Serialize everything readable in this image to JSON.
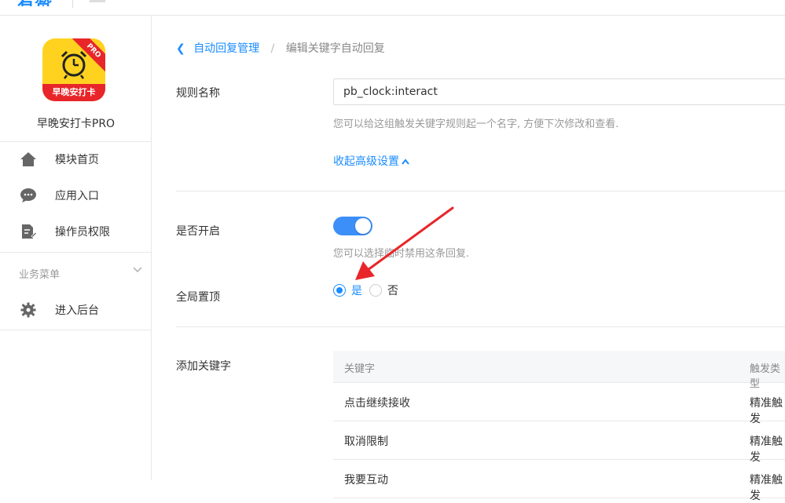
{
  "topbar": {
    "logo_text": "有赞"
  },
  "sidebar": {
    "app_name": "早晚安打卡PRO",
    "app_icon": {
      "ribbon": "PRO",
      "band": "早晚安打卡"
    },
    "items": [
      {
        "label": "模块首页",
        "icon": "home-icon"
      },
      {
        "label": "应用入口",
        "icon": "chat-bubble-icon"
      },
      {
        "label": "操作员权限",
        "icon": "document-edit-icon"
      }
    ],
    "group_label": "业务菜单",
    "group_items": [
      {
        "label": "进入后台",
        "icon": "gear-icon"
      }
    ]
  },
  "breadcrumb": {
    "parent": "自动回复管理",
    "separator": "/",
    "current": "编辑关键字自动回复"
  },
  "form": {
    "rule_name": {
      "label": "规则名称",
      "value": "pb_clock:interact",
      "help": "您可以给这组触发关键字规则起一个名字, 方便下次修改和查看."
    },
    "advanced_toggle": "收起高级设置",
    "enabled": {
      "label": "是否开启",
      "on": true,
      "help": "您可以选择临时禁用这条回复."
    },
    "global_top": {
      "label": "全局置顶",
      "options": [
        "是",
        "否"
      ],
      "selected": "是"
    },
    "keywords": {
      "label": "添加关键字",
      "columns": [
        "关键字",
        "触发类型"
      ],
      "rows": [
        [
          "点击继续接收",
          "精准触发"
        ],
        [
          "取消限制",
          "精准触发"
        ],
        [
          "我要互动",
          "精准触发"
        ]
      ]
    }
  },
  "colors": {
    "accent": "#1a8cff",
    "toggle_on": "#3c8ff8",
    "annotation_arrow": "#e8262a"
  }
}
